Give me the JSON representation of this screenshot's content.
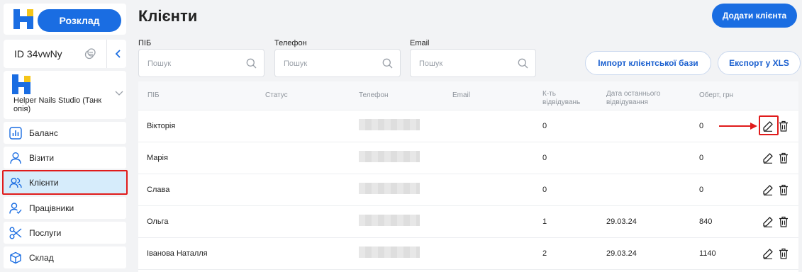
{
  "sidebar": {
    "schedule_label": "Розклад",
    "account_id": "ID 34vwNy",
    "studio_name": "Helper Nails Studio (Танк опія)",
    "nav": [
      {
        "label": "Баланс",
        "icon": "chart-bar-icon"
      },
      {
        "label": "Візити",
        "icon": "user-icon"
      },
      {
        "label": "Клієнти",
        "icon": "users-icon",
        "active": true
      },
      {
        "label": "Працівники",
        "icon": "user-check-icon"
      },
      {
        "label": "Послуги",
        "icon": "scissors-icon"
      },
      {
        "label": "Склад",
        "icon": "box-icon"
      }
    ]
  },
  "header": {
    "title": "Клієнти",
    "add_client_label": "Додати клієнта"
  },
  "filters": {
    "name_label": "ПІБ",
    "phone_label": "Телефон",
    "email_label": "Email",
    "placeholder": "Пошук"
  },
  "actions": {
    "import_label": "Імпорт клієнтської бази",
    "export_label": "Експорт у XLS"
  },
  "table": {
    "columns": [
      "ПІБ",
      "Статус",
      "Телефон",
      "Email",
      "К-ть відвідувань",
      "Дата останнього відвідування",
      "Оберт, грн"
    ],
    "rows": [
      {
        "name": "Вікторія",
        "status": "",
        "visits": "0",
        "last_visit": "",
        "turnover": "0"
      },
      {
        "name": "Марія",
        "status": "",
        "visits": "0",
        "last_visit": "",
        "turnover": "0"
      },
      {
        "name": "Слава",
        "status": "",
        "visits": "0",
        "last_visit": "",
        "turnover": "0"
      },
      {
        "name": "Ольга",
        "status": "",
        "visits": "1",
        "last_visit": "29.03.24",
        "turnover": "840"
      },
      {
        "name": "Іванова Наталля",
        "status": "",
        "visits": "2",
        "last_visit": "29.03.24",
        "turnover": "1140"
      }
    ]
  },
  "colors": {
    "accent": "#1a6de2",
    "highlight": "#e01b1b",
    "active_nav": "#d6ecfb"
  }
}
